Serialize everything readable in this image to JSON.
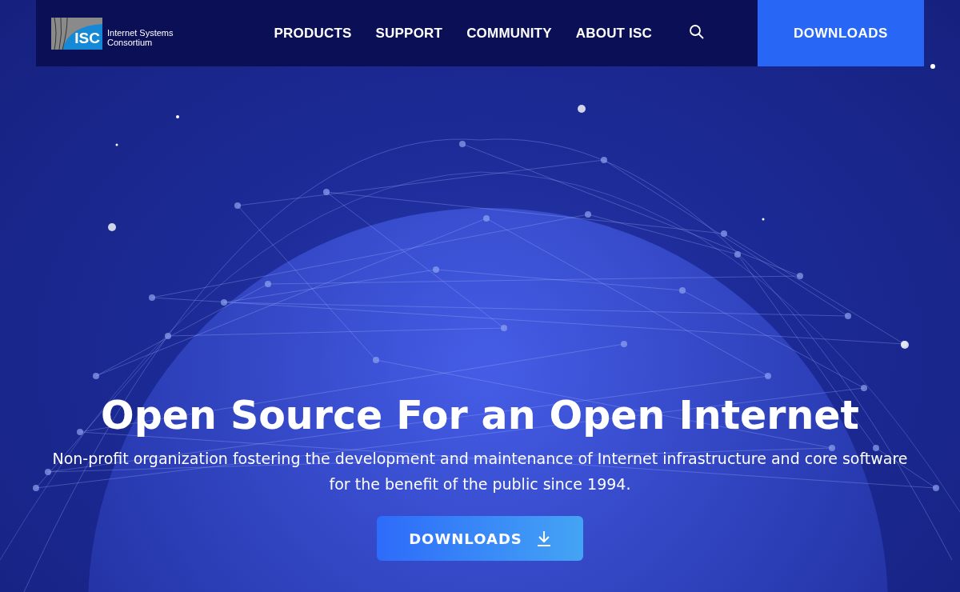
{
  "header": {
    "logo": {
      "mark": "ISC",
      "name_lines": [
        "Internet Systems",
        "Consortium"
      ]
    },
    "nav": [
      {
        "label": "PRODUCTS"
      },
      {
        "label": "SUPPORT"
      },
      {
        "label": "COMMUNITY"
      },
      {
        "label": "ABOUT ISC"
      }
    ],
    "cta": "DOWNLOADS"
  },
  "hero": {
    "title": "Open Source For an Open Internet",
    "subtitle": "Non-profit organization fostering the development and maintenance of Internet infrastructure and core software for the benefit of the public since 1994.",
    "button": "DOWNLOADS"
  }
}
